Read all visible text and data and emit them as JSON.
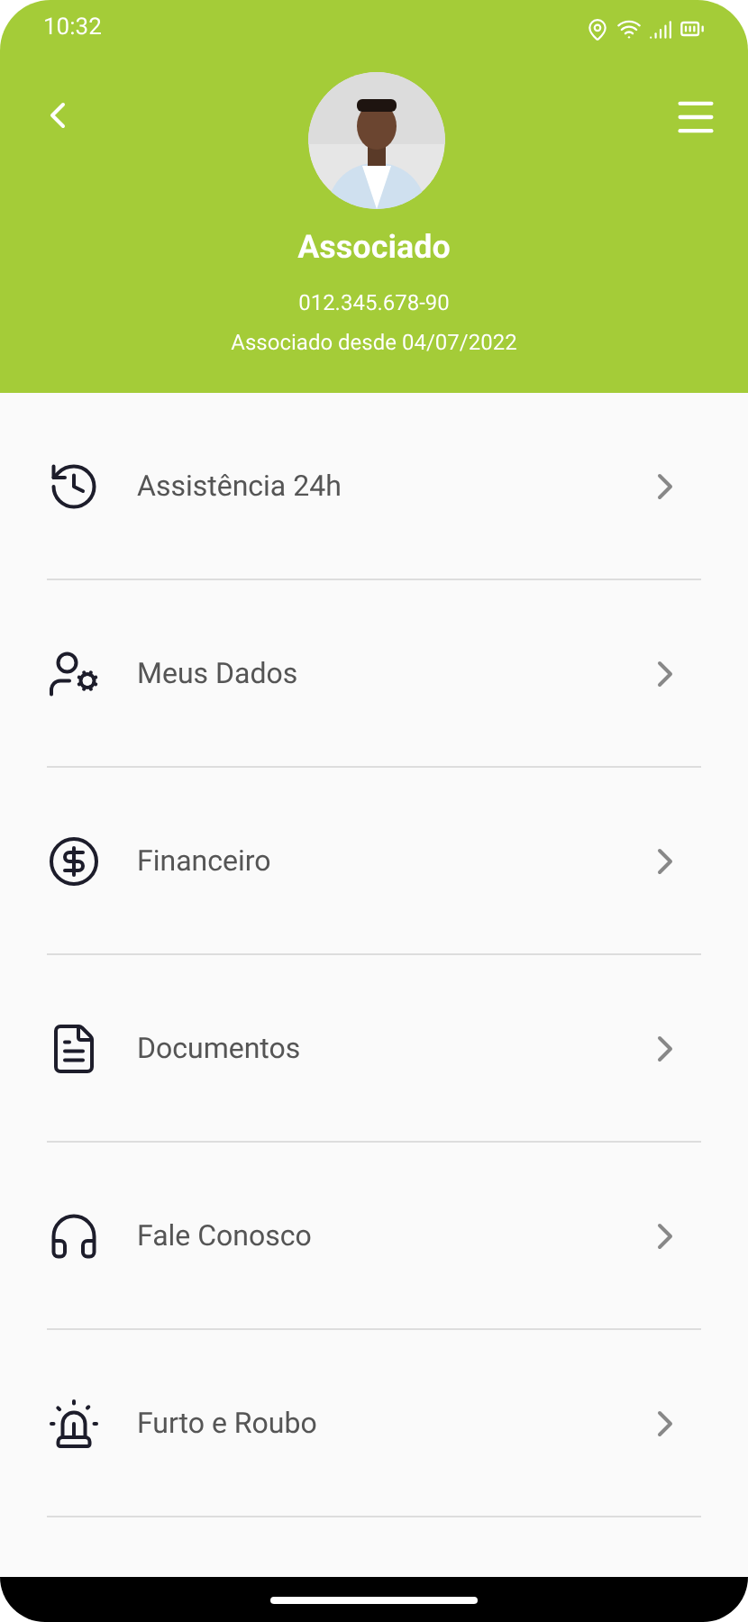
{
  "status_bar": {
    "time": "10:32"
  },
  "profile": {
    "name": "Associado",
    "document": "012.345.678-90",
    "since": "Associado desde 04/07/2022"
  },
  "menu": [
    {
      "label": "Assistência 24h",
      "kind": "assistance"
    },
    {
      "label": "Meus Dados",
      "kind": "user"
    },
    {
      "label": "Financeiro",
      "kind": "money"
    },
    {
      "label": "Documentos",
      "kind": "document"
    },
    {
      "label": "Fale Conosco",
      "kind": "support"
    },
    {
      "label": "Furto e Roubo",
      "kind": "alarm"
    }
  ]
}
